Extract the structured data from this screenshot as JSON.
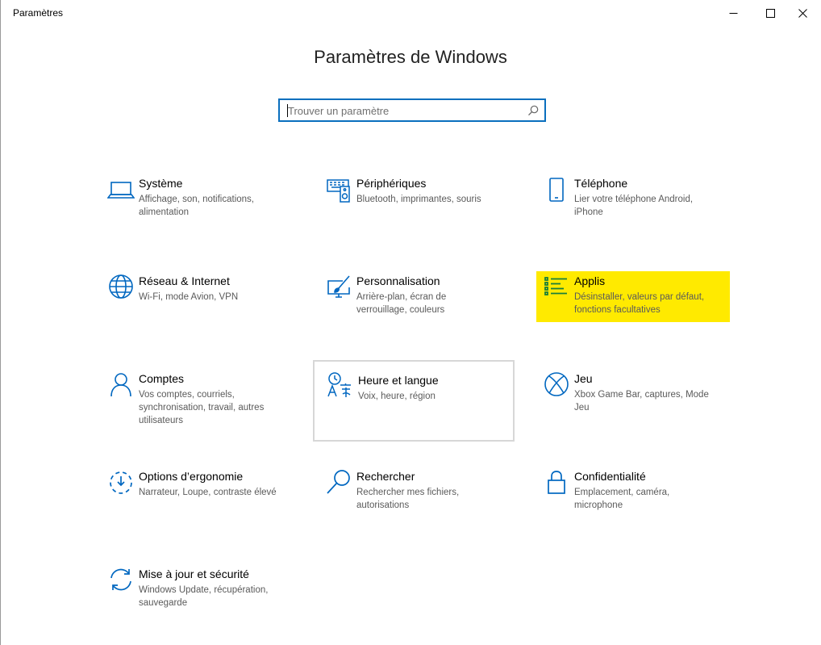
{
  "window": {
    "title": "Paramètres",
    "minimize_icon": "minimize-icon",
    "maximize_icon": "maximize-icon",
    "close_icon": "close-icon"
  },
  "header": {
    "title": "Paramètres de Windows"
  },
  "search": {
    "placeholder": "Trouver un paramètre",
    "value": "",
    "icon": "search-icon"
  },
  "accent_color": "#0067C0",
  "highlight_color": "#FFEA00",
  "tiles": [
    {
      "title": "Système",
      "desc": "Affichage, son, notifications, alimentation",
      "icon": "laptop-icon"
    },
    {
      "title": "Périphériques",
      "desc": "Bluetooth, imprimantes, souris",
      "icon": "devices-icon"
    },
    {
      "title": "Téléphone",
      "desc": "Lier votre téléphone Android, iPhone",
      "icon": "phone-icon"
    },
    {
      "title": "Réseau & Internet",
      "desc": "Wi-Fi, mode Avion, VPN",
      "icon": "globe-icon"
    },
    {
      "title": "Personnalisation",
      "desc": "Arrière-plan, écran de verrouillage, couleurs",
      "icon": "paintbrush-monitor-icon"
    },
    {
      "title": "Applis",
      "desc": "Désinstaller, valeurs par défaut, fonctions facultatives",
      "icon": "apps-list-icon",
      "highlighted": true
    },
    {
      "title": "Comptes",
      "desc": "Vos comptes, courriels, synchronisation, travail, autres utilisateurs",
      "icon": "person-icon"
    },
    {
      "title": "Heure et langue",
      "desc": "Voix, heure, région",
      "icon": "time-language-icon",
      "hovered": true
    },
    {
      "title": "Jeu",
      "desc": "Xbox Game Bar, captures, Mode Jeu",
      "icon": "xbox-icon"
    },
    {
      "title": "Options d’ergonomie",
      "desc": "Narrateur, Loupe, contraste élevé",
      "icon": "ease-of-access-icon"
    },
    {
      "title": "Rechercher",
      "desc": "Rechercher mes fichiers, autorisations",
      "icon": "magnifier-icon"
    },
    {
      "title": "Confidentialité",
      "desc": "Emplacement, caméra, microphone",
      "icon": "lock-icon"
    },
    {
      "title": "Mise à jour et sécurité",
      "desc": "Windows Update, récupération, sauvegarde",
      "icon": "update-sync-icon"
    }
  ]
}
